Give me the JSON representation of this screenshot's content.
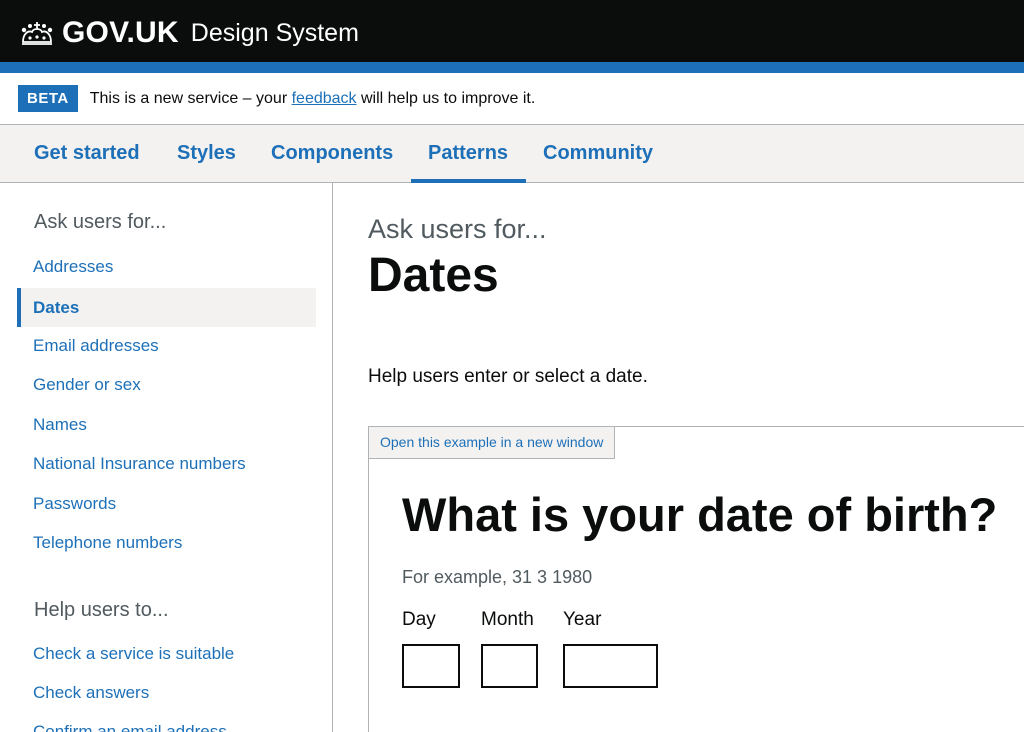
{
  "header": {
    "logo_text": "GOV.UK",
    "service_name": "Design System"
  },
  "phase_banner": {
    "tag": "BETA",
    "text_before": "This is a new service – your ",
    "link_text": "feedback",
    "text_after": " will help us to improve it."
  },
  "topnav": {
    "items": [
      {
        "label": "Get started"
      },
      {
        "label": "Styles"
      },
      {
        "label": "Components"
      },
      {
        "label": "Patterns"
      },
      {
        "label": "Community"
      }
    ],
    "active": "Patterns"
  },
  "sidebar": {
    "sections": [
      {
        "heading": "Ask users for...",
        "items": [
          {
            "label": "Addresses"
          },
          {
            "label": "Dates"
          },
          {
            "label": "Email addresses"
          },
          {
            "label": "Gender or sex"
          },
          {
            "label": "Names"
          },
          {
            "label": "National Insurance numbers"
          },
          {
            "label": "Passwords"
          },
          {
            "label": "Telephone numbers"
          }
        ]
      },
      {
        "heading": "Help users to...",
        "items": [
          {
            "label": "Check a service is suitable"
          },
          {
            "label": "Check answers"
          },
          {
            "label": "Confirm an email address"
          }
        ]
      }
    ],
    "active": "Dates"
  },
  "main": {
    "caption": "Ask users for...",
    "title": "Dates",
    "lede": "Help users enter or select a date."
  },
  "example": {
    "open_link": "Open this example in a new window",
    "question": "What is your date of birth?",
    "hint": "For example, 31 3 1980",
    "fields": [
      {
        "label": "Day",
        "value": ""
      },
      {
        "label": "Month",
        "value": ""
      },
      {
        "label": "Year",
        "value": ""
      }
    ]
  },
  "colors": {
    "brand_blue": "#1d70b8",
    "header_black": "#0b0c0c",
    "panel_grey": "#f3f2f1",
    "secondary_text": "#505a5f",
    "border_grey": "#b1b4b6"
  }
}
